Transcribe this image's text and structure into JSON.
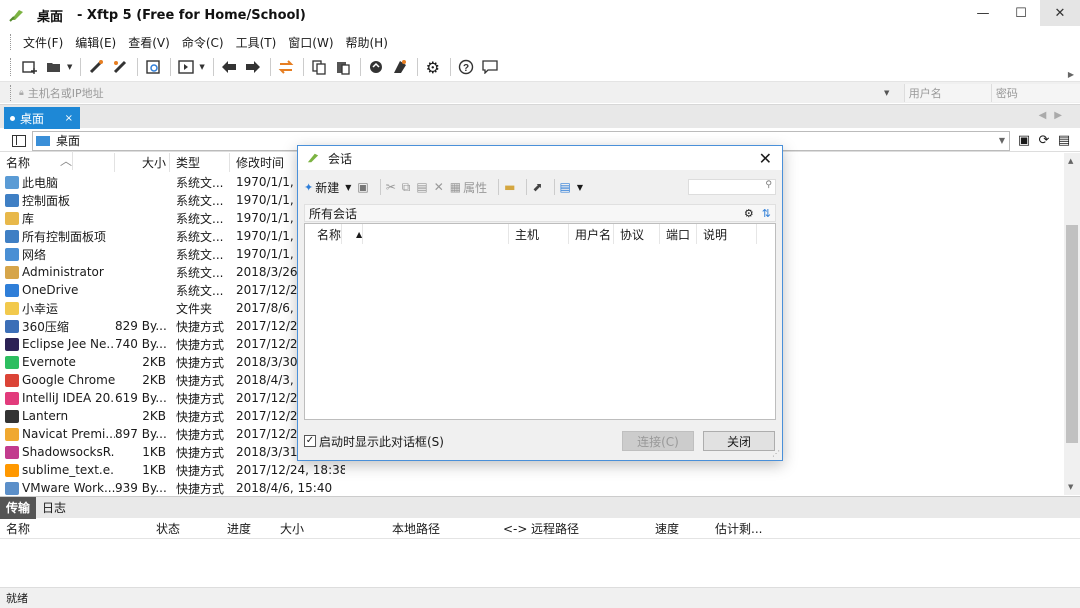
{
  "window": {
    "location": "桌面",
    "app_title": "- Xftp 5 (Free for Home/School)",
    "minimize": "—",
    "maximize": "☐",
    "close": "✕"
  },
  "menu": [
    "文件(F)",
    "编辑(E)",
    "查看(V)",
    "命令(C)",
    "工具(T)",
    "窗口(W)",
    "帮助(H)"
  ],
  "address": {
    "host_placeholder": "主机名或IP地址",
    "user_placeholder": "用户名",
    "password_placeholder": "密码"
  },
  "tabs": {
    "active_label": "桌面",
    "close": "×",
    "nav": "◀▶"
  },
  "path": {
    "current": "桌面"
  },
  "file_list": {
    "columns": {
      "name": "名称",
      "size": "大小",
      "type": "类型",
      "modified": "修改时间"
    },
    "rows": [
      {
        "name": "此电脑",
        "size": "",
        "type": "系统文...",
        "modified": "1970/1/1, 8",
        "icon": "computer-icon",
        "color": "#5a9bd5"
      },
      {
        "name": "控制面板",
        "size": "",
        "type": "系统文...",
        "modified": "1970/1/1, 8",
        "icon": "control-panel-icon",
        "color": "#3f7fc4"
      },
      {
        "name": "库",
        "size": "",
        "type": "系统文...",
        "modified": "1970/1/1, 8",
        "icon": "library-icon",
        "color": "#e8b84a"
      },
      {
        "name": "所有控制面板项",
        "size": "",
        "type": "系统文...",
        "modified": "1970/1/1, 8",
        "icon": "control-panel-items-icon",
        "color": "#3f7fc4"
      },
      {
        "name": "网络",
        "size": "",
        "type": "系统文...",
        "modified": "1970/1/1, 8",
        "icon": "network-icon",
        "color": "#4a8fd4"
      },
      {
        "name": "Administrator",
        "size": "",
        "type": "系统文...",
        "modified": "2018/3/26,",
        "icon": "user-folder-icon",
        "color": "#d6a54a"
      },
      {
        "name": "OneDrive",
        "size": "",
        "type": "系统文...",
        "modified": "2017/12/24",
        "icon": "onedrive-icon",
        "color": "#2f7ed8"
      },
      {
        "name": "小幸运",
        "size": "",
        "type": "文件夹",
        "modified": "2017/8/6, 2",
        "icon": "folder-icon",
        "color": "#f2c94c"
      },
      {
        "name": "360压缩",
        "size": "829 By...",
        "type": "快捷方式",
        "modified": "2017/12/24",
        "icon": "zip-app-icon",
        "color": "#3c6fb7"
      },
      {
        "name": "Eclipse Jee Ne...",
        "size": "740 By...",
        "type": "快捷方式",
        "modified": "2017/12/24",
        "icon": "eclipse-icon",
        "color": "#2c2255"
      },
      {
        "name": "Evernote",
        "size": "2KB",
        "type": "快捷方式",
        "modified": "2018/3/30,",
        "icon": "evernote-icon",
        "color": "#2dbe60"
      },
      {
        "name": "Google Chrome",
        "size": "2KB",
        "type": "快捷方式",
        "modified": "2018/4/3, 2",
        "icon": "chrome-icon",
        "color": "#db4437"
      },
      {
        "name": "IntelliJ IDEA 20...",
        "size": "619 By...",
        "type": "快捷方式",
        "modified": "2017/12/24",
        "icon": "intellij-icon",
        "color": "#e23b7c"
      },
      {
        "name": "Lantern",
        "size": "2KB",
        "type": "快捷方式",
        "modified": "2017/12/24",
        "icon": "lantern-icon",
        "color": "#333333"
      },
      {
        "name": "Navicat Premi...",
        "size": "897 By...",
        "type": "快捷方式",
        "modified": "2017/12/28",
        "icon": "navicat-icon",
        "color": "#f0a830"
      },
      {
        "name": "ShadowsocksR...",
        "size": "1KB",
        "type": "快捷方式",
        "modified": "2018/3/31,",
        "icon": "shadowsocks-icon",
        "color": "#c23b8e"
      },
      {
        "name": "sublime_text.e...",
        "size": "1KB",
        "type": "快捷方式",
        "modified": "2017/12/24, 18:38",
        "icon": "sublime-icon",
        "color": "#ff9800"
      },
      {
        "name": "VMware Work...",
        "size": "939 By...",
        "type": "快捷方式",
        "modified": "2018/4/6, 15:40",
        "icon": "vmware-icon",
        "color": "#5b8fc9"
      }
    ]
  },
  "bottom_panel": {
    "tabs": [
      "传输",
      "日志"
    ],
    "columns": [
      "名称",
      "状态",
      "进度",
      "大小",
      "本地路径",
      "<->",
      "远程路径",
      "速度",
      "估计剩..."
    ]
  },
  "status": "就绪",
  "dialog": {
    "title": "会话",
    "toolbar": {
      "new": "新建",
      "properties": "属性"
    },
    "folder": "所有会话",
    "columns": [
      "名称",
      "主机",
      "用户名",
      "协议",
      "端口",
      "说明"
    ],
    "show_on_start": "启动时显示此对话框(S)",
    "connect": "连接(C)",
    "close": "关闭"
  }
}
